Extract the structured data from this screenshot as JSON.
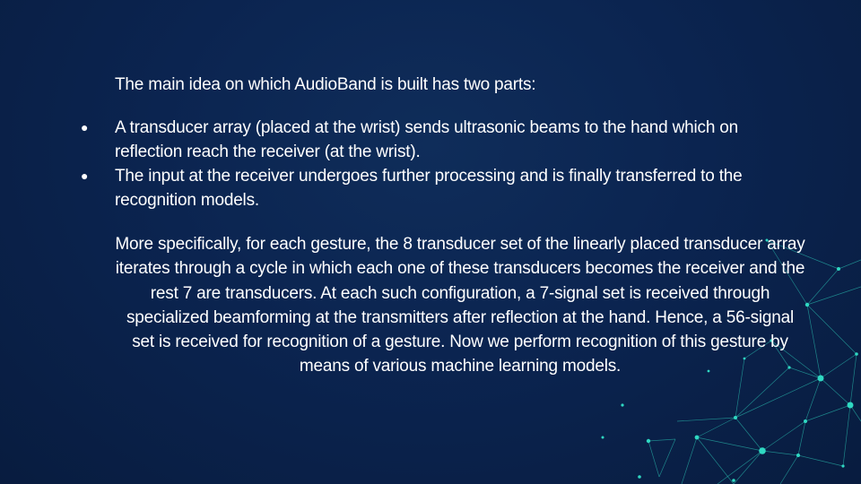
{
  "slide": {
    "intro": "The main idea on which AudioBand is built has two parts:",
    "bullets": [
      {
        "marker": "●",
        "text": "A transducer array (placed at the wrist) sends ultrasonic beams to the hand which on reflection reach the receiver (at the wrist)."
      },
      {
        "marker": "●",
        "text": "The input at the receiver undergoes further processing and is finally transferred to the recognition models."
      }
    ],
    "detail": "More specifically, for each gesture, the 8 transducer set of the linearly placed transducer array iterates through a cycle in which each one of these transducers becomes the receiver and the rest 7 are transducers. At each such configuration, a 7-signal set is received through specialized beamforming at the transmitters after reflection at the hand. Hence, a 56-signal set is received for recognition of a gesture. Now we perform recognition of this gesture by means of various machine learning models."
  },
  "colors": {
    "background": "#0b2450",
    "text": "#ffffff",
    "accent_network": "#2fd8c2"
  }
}
